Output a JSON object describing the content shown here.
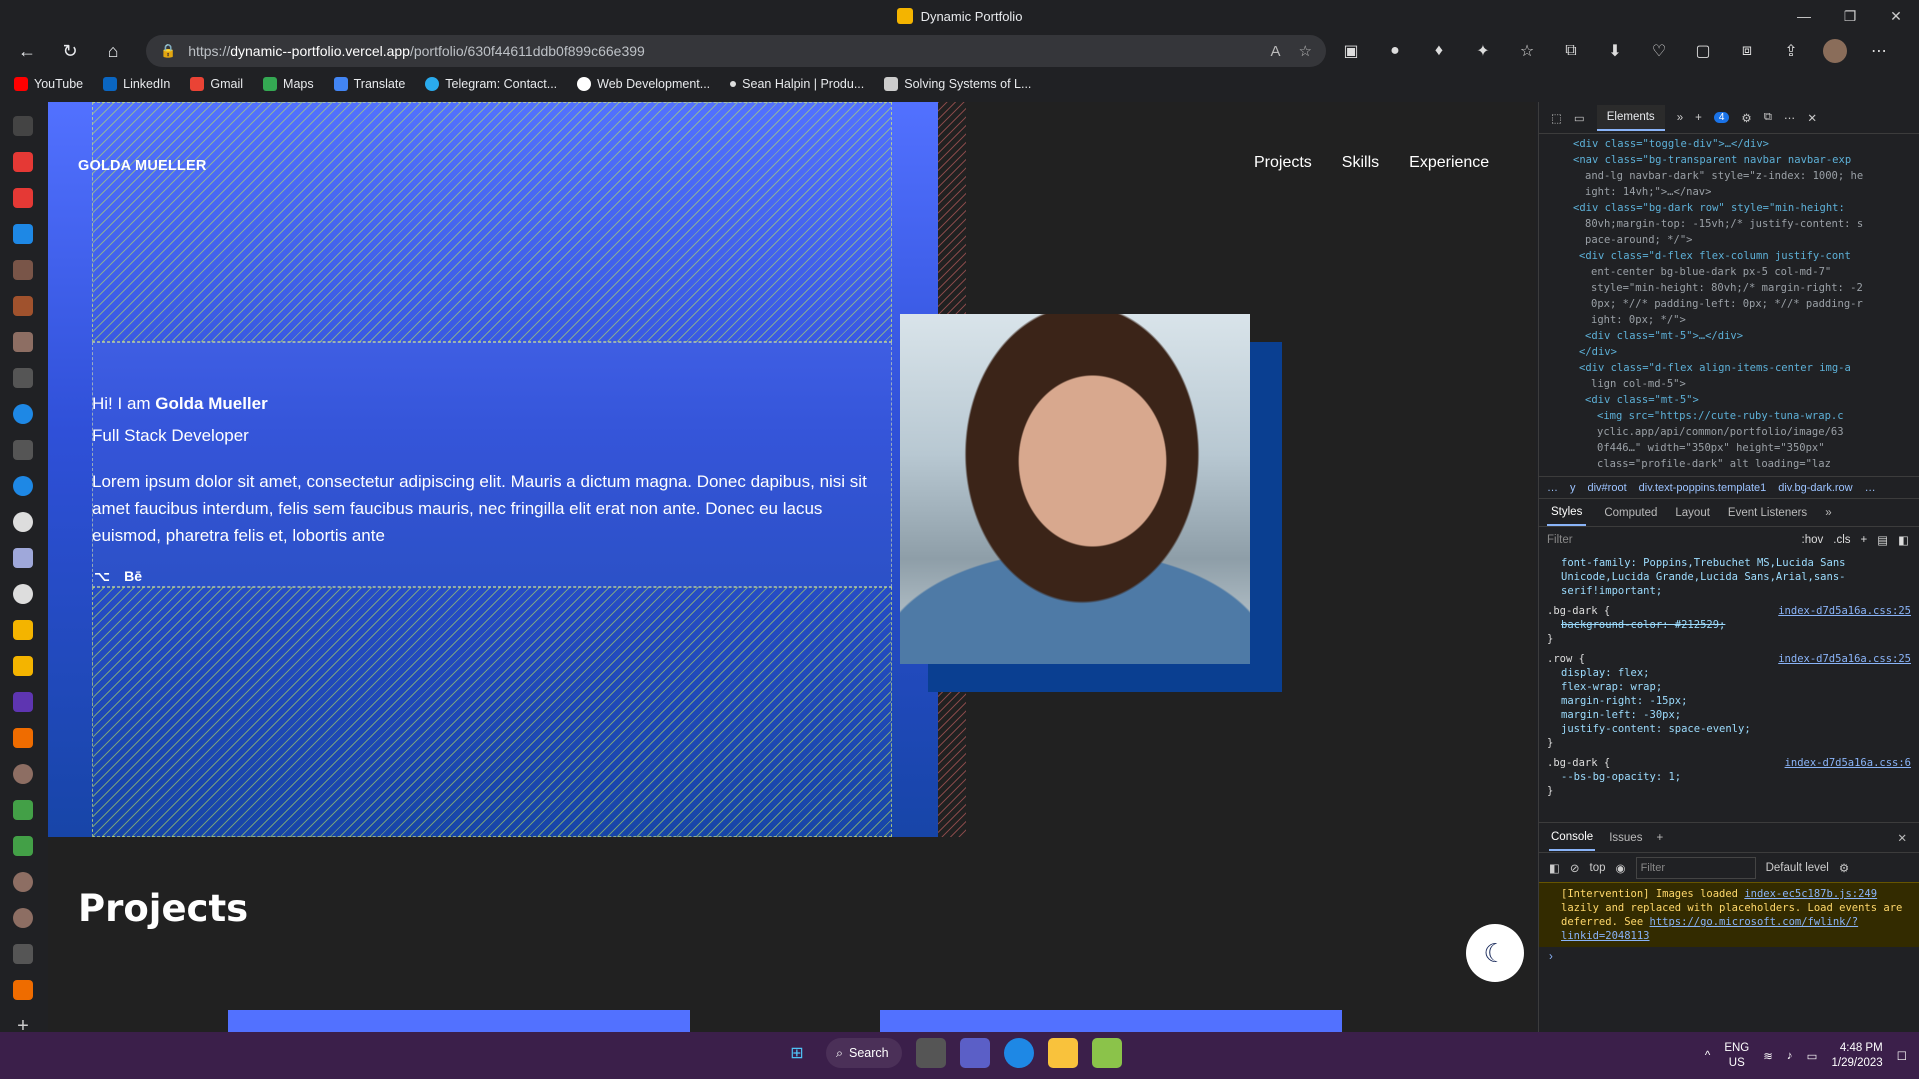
{
  "window": {
    "title": "Dynamic Portfolio"
  },
  "browser": {
    "url_prefix": "https://",
    "url_host": "dynamic--portfolio.vercel.app",
    "url_path": "/portfolio/630f44611ddb0f899c66e399",
    "bookmarks": [
      "YouTube",
      "LinkedIn",
      "Gmail",
      "Maps",
      "Translate",
      "Telegram: Contact...",
      "Web Development...",
      "Sean Halpin | Produ...",
      "Solving Systems of L..."
    ]
  },
  "site": {
    "brand": "GOLDA MUELLER",
    "nav": [
      "Projects",
      "Skills",
      "Experience"
    ],
    "greeting_prefix": "Hi! I am ",
    "name": "Golda Mueller",
    "role": "Full Stack Developer",
    "about": "Lorem ipsum dolor sit amet, consectetur adipiscing elit. Mauris a dictum magna. Donec dapibus, nisi sit amet faucibus interdum, felis sem faucibus mauris, nec fringilla elit erat non ante. Donec eu lacus euismod, pharetra felis et, lobortis ante",
    "social_behance": "Bē",
    "projects_heading": "Projects"
  },
  "devtools": {
    "tabs": [
      "Elements"
    ],
    "badge_count": "4",
    "dom_lines": [
      "<div class=\"toggle-div\">…</div>",
      "<nav class=\"bg-transparent navbar navbar-exp",
      "and-lg navbar-dark\" style=\"z-index: 1000; he",
      "ight: 14vh;\">…</nav>",
      "<div class=\"bg-dark row\" style=\"min-height:",
      "80vh;margin-top: -15vh;/* justify-content: s",
      "pace-around; */\">",
      "<div class=\"d-flex flex-column justify-cont",
      "ent-center bg-blue-dark px-5 col-md-7\"",
      "style=\"min-height: 80vh;/* margin-right: -2",
      "0px; *//* padding-left: 0px; *//* padding-r",
      "ight: 0px; */\">",
      "<div class=\"mt-5\">…</div>",
      "</div>",
      "<div class=\"d-flex align-items-center img-a",
      "lign col-md-5\">",
      "<div class=\"mt-5\">",
      "<img src=\"https://cute-ruby-tuna-wrap.c",
      "yclic.app/api/common/portfolio/image/63",
      "0f446…\" width=\"350px\" height=\"350px\"",
      "class=\"profile-dark\" alt loading=\"laz"
    ],
    "breadcrumbs": [
      "…",
      "y",
      "div#root",
      "div.text-poppins.template1",
      "div.bg-dark.row",
      "…"
    ],
    "style_tabs": [
      "Styles",
      "Computed",
      "Layout",
      "Event Listeners"
    ],
    "filter_placeholder": "Filter",
    "hov": ":hov",
    "cls": ".cls",
    "font_family_line": "font-family: Poppins,Trebuchet MS,Lucida Sans Unicode,Lucida Grande,Lucida Sans,Arial,sans-serif!important;",
    "rules": [
      {
        "selector": ".bg-dark {",
        "source": "index-d7d5a16a.css:25",
        "props": [
          "background-color: #212529;"
        ]
      },
      {
        "selector": ".row {",
        "source": "index-d7d5a16a.css:25",
        "props": [
          "display: flex;",
          "flex-wrap: wrap;",
          "margin-right: -15px;",
          "margin-left: -30px;",
          "justify-content: space-evenly;"
        ]
      },
      {
        "selector": ".bg-dark {",
        "source": "index-d7d5a16a.css:6",
        "props": [
          "--bs-bg-opacity: 1;"
        ]
      }
    ],
    "console_tabs": [
      "Console",
      "Issues"
    ],
    "context": "top",
    "default_level": "Default level",
    "warning_text": "[Intervention] Images loaded ",
    "warning_link": "index-ec5c187b.js:249",
    "warning_text2": " lazily and replaced with placeholders. Load events are deferred. See ",
    "warning_url": "https://go.microsoft.com/fwlink/?linkid=2048113"
  },
  "taskbar": {
    "search": "Search",
    "lang1": "ENG",
    "lang2": "US",
    "time": "4:48 PM",
    "date": "1/29/2023"
  }
}
